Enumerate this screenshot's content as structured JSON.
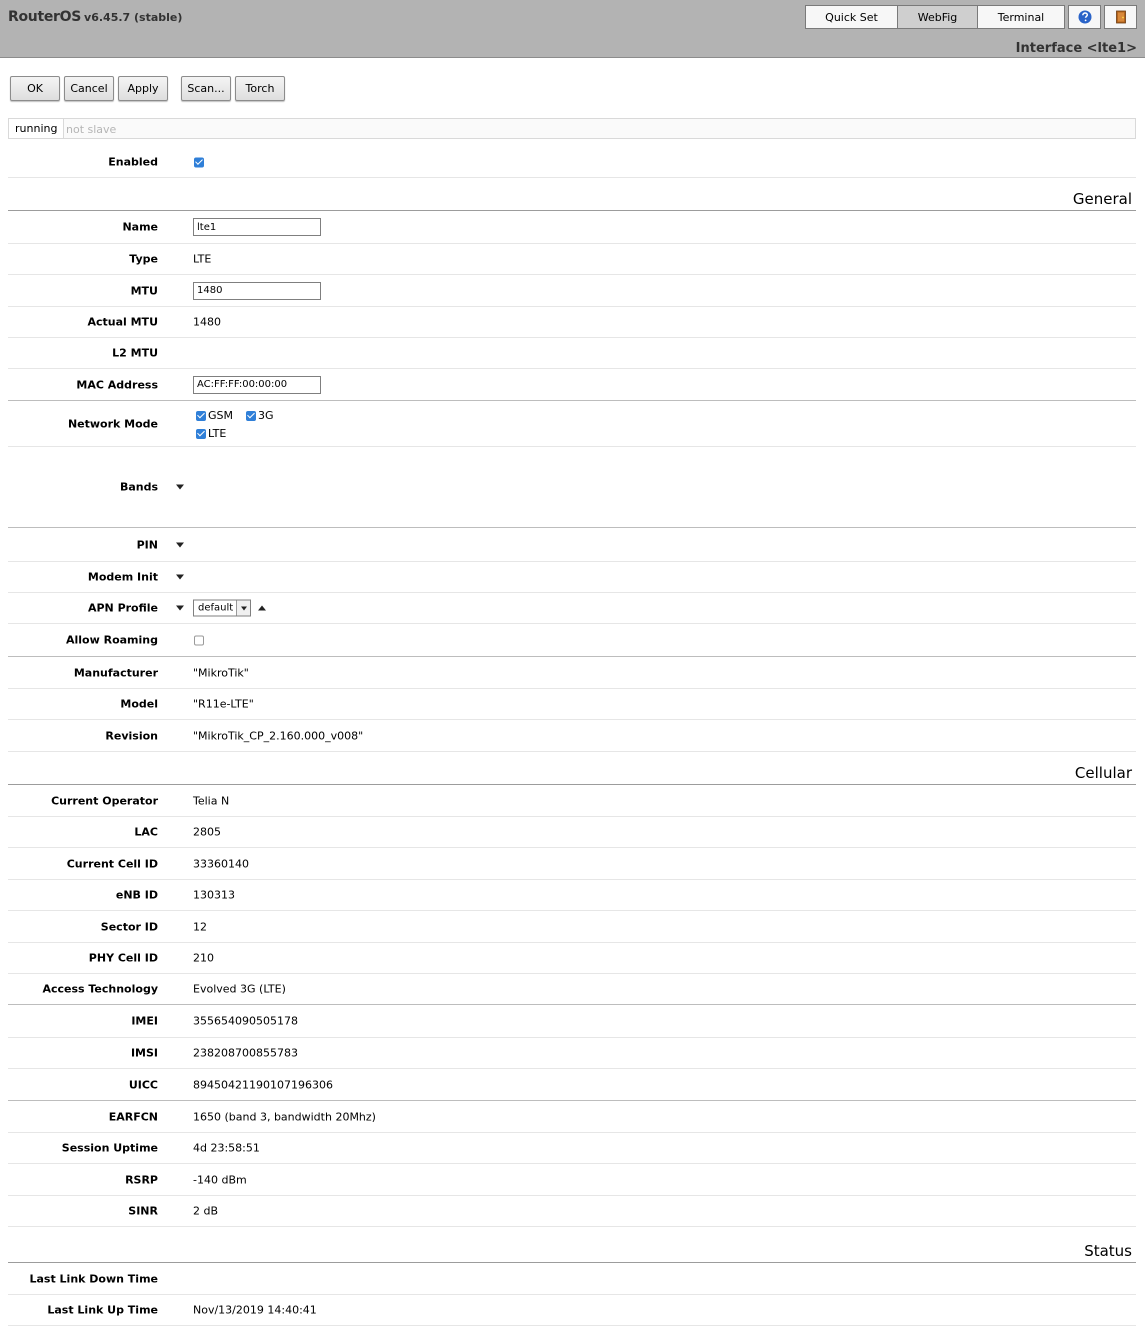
{
  "brand": {
    "os": "RouterOS",
    "version": "v6.45.7 (stable)"
  },
  "topnav": {
    "quick_set": "Quick Set",
    "webfig": "WebFig",
    "terminal": "Terminal",
    "help_icon": "help-icon",
    "logout_icon": "logout-icon"
  },
  "page_title": "Interface <lte1>",
  "actions": {
    "ok": "OK",
    "cancel": "Cancel",
    "apply": "Apply",
    "scan": "Scan...",
    "torch": "Torch"
  },
  "status": {
    "running": "running",
    "slave": "not slave"
  },
  "enabled": {
    "label": "Enabled",
    "checked": true
  },
  "sections": {
    "general": "General",
    "cellular": "Cellular",
    "status": "Status"
  },
  "general": {
    "name_label": "Name",
    "name_value": "lte1",
    "type_label": "Type",
    "type_value": "LTE",
    "mtu_label": "MTU",
    "mtu_value": "1480",
    "actual_mtu_label": "Actual MTU",
    "actual_mtu_value": "1480",
    "l2mtu_label": "L2 MTU",
    "l2mtu_value": "",
    "mac_label": "MAC Address",
    "mac_value": "AC:FF:FF:00:00:00",
    "network_mode_label": "Network Mode",
    "network_modes": [
      {
        "label": "GSM",
        "checked": true
      },
      {
        "label": "3G",
        "checked": true
      },
      {
        "label": "LTE",
        "checked": true
      }
    ],
    "bands_label": "Bands",
    "pin_label": "PIN",
    "modem_init_label": "Modem Init",
    "apn_profile_label": "APN Profile",
    "apn_profile_value": "default",
    "allow_roaming_label": "Allow Roaming",
    "allow_roaming_checked": false,
    "manufacturer_label": "Manufacturer",
    "manufacturer_value": "\"MikroTik\"",
    "model_label": "Model",
    "model_value": "\"R11e-LTE\"",
    "revision_label": "Revision",
    "revision_value": "\"MikroTik_CP_2.160.000_v008\""
  },
  "cellular": {
    "rows": [
      {
        "label": "Current Operator",
        "value": "Telia N"
      },
      {
        "label": "LAC",
        "value": "2805"
      },
      {
        "label": "Current Cell ID",
        "value": "33360140"
      },
      {
        "label": "eNB ID",
        "value": "130313"
      },
      {
        "label": "Sector ID",
        "value": "12"
      },
      {
        "label": "PHY Cell ID",
        "value": "210"
      },
      {
        "label": "Access Technology",
        "value": "Evolved 3G (LTE)"
      },
      {
        "label": "IMEI",
        "value": "355654090505178"
      },
      {
        "label": "IMSI",
        "value": "238208700855783"
      },
      {
        "label": "UICC",
        "value": "89450421190107196306"
      },
      {
        "label": "EARFCN",
        "value": "1650 (band 3, bandwidth 20Mhz)"
      },
      {
        "label": "Session Uptime",
        "value": "4d 23:58:51"
      },
      {
        "label": "RSRP",
        "value": "-140 dBm"
      },
      {
        "label": "SINR",
        "value": "2 dB"
      }
    ]
  },
  "status_section": {
    "rows": [
      {
        "label": "Last Link Down Time",
        "value": ""
      },
      {
        "label": "Last Link Up Time",
        "value": "Nov/13/2019 14:40:41"
      }
    ]
  }
}
